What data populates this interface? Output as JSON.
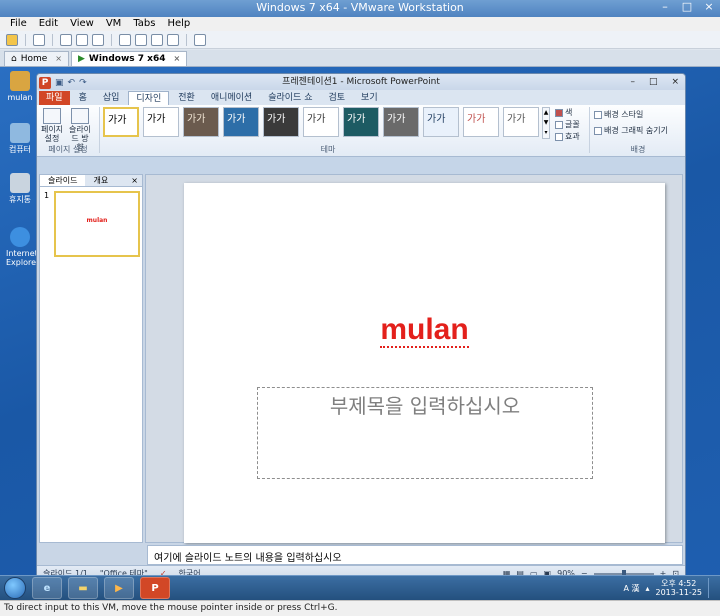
{
  "vmware": {
    "title": "Windows 7 x64 - VMware Workstation",
    "menu": [
      "File",
      "Edit",
      "View",
      "VM",
      "Tabs",
      "Help"
    ],
    "tabs": [
      {
        "label": "Home",
        "close": "×"
      },
      {
        "label": "Windows 7 x64",
        "close": "×"
      }
    ],
    "window_buttons": [
      "–",
      "□",
      "×"
    ],
    "hint": "To direct input to this VM, move the mouse pointer inside or press Ctrl+G."
  },
  "desktop": {
    "icons": [
      {
        "label": "mulan",
        "color": "#d9a541"
      },
      {
        "label": "컴퓨터",
        "color": "#8fb9e0"
      },
      {
        "label": "휴지통",
        "color": "#c9d4df"
      },
      {
        "label": "Internet Explorer",
        "color": "#3d8fe0"
      }
    ]
  },
  "powerpoint": {
    "title": "프레젠테이션1 - Microsoft PowerPoint",
    "logo": "P",
    "window_buttons": [
      "–",
      "□",
      "×"
    ],
    "ribbon_tabs": [
      "파일",
      "홈",
      "삽입",
      "디자인",
      "전환",
      "애니메이션",
      "슬라이드 쇼",
      "검토",
      "보기"
    ],
    "active_tab": "디자인",
    "page_setup": {
      "btn1": "페이지 설정",
      "btn2": "슬라이드 방향",
      "group": "페이지 설정"
    },
    "themes": {
      "group": "테마",
      "items": [
        {
          "text": "가가",
          "bg": "#ffffff",
          "fg": "#000000"
        },
        {
          "text": "가가",
          "bg": "#ffffff",
          "fg": "#000000"
        },
        {
          "text": "가가",
          "bg": "#6b5b4e",
          "fg": "#f1e5d4"
        },
        {
          "text": "가가",
          "bg": "#2d6ea8",
          "fg": "#ffffff"
        },
        {
          "text": "가가",
          "bg": "#3a3a3a",
          "fg": "#ffffff"
        },
        {
          "text": "가가",
          "bg": "#ffffff",
          "fg": "#333333"
        },
        {
          "text": "가가",
          "bg": "#1d5b63",
          "fg": "#ffffff"
        },
        {
          "text": "가가",
          "bg": "#6a6a6a",
          "fg": "#ffffff"
        },
        {
          "text": "가가",
          "bg": "#e9f1fb",
          "fg": "#1e3b5e"
        },
        {
          "text": "가가",
          "bg": "#ffffff",
          "fg": "#c0504d"
        },
        {
          "text": "가가",
          "bg": "#ffffff",
          "fg": "#555555"
        }
      ],
      "colors": "색",
      "fonts": "글꼴",
      "effects": "효과"
    },
    "background": {
      "styles": "배경 스타일",
      "hide": "배경 그래픽 숨기기",
      "group": "배경"
    },
    "pane_tabs": [
      "슬라이드",
      "개요"
    ],
    "pane_close": "×",
    "slide_number": "1",
    "slide": {
      "title": "mulan",
      "subtitle_placeholder": "부제목을 입력하십시오"
    },
    "notes_placeholder": "여기에 슬라이드 노트의 내용을 입력하십시오",
    "status": {
      "slide_info": "슬라이드 1/1",
      "theme": "\"Office 테마\"",
      "language": "한국어",
      "zoom": "90%"
    }
  },
  "taskbar": {
    "pinned": [
      "IE",
      "Explorer",
      "Media",
      "P"
    ],
    "ime": "A 漢",
    "clock_time": "오후 4:52",
    "clock_date": "2013-11-25"
  },
  "colors": {
    "title_red": "#e3201b",
    "file_tab": "#d24726"
  }
}
